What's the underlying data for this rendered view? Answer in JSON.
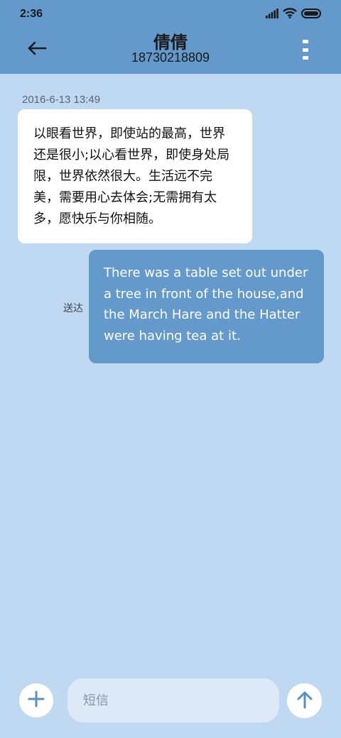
{
  "status_bar": {
    "time": "2:36",
    "icons": [
      "signal-icon",
      "wifi-icon",
      "battery-icon"
    ]
  },
  "header": {
    "contact_name": "倩倩",
    "contact_number": "18730218809",
    "back_icon": "arrow-left-icon",
    "menu_icon": "more-vertical-icon"
  },
  "conversation": {
    "timestamp": "2016-6-13 13:49",
    "messages": [
      {
        "direction": "incoming",
        "text": "以眼看世界，即使站的最高，世界还是很小;以心看世界，即使身处局限，世界依然很大。生活远不完美，需要用心去体会;无需拥有太多，愿快乐与你相随。"
      },
      {
        "direction": "outgoing",
        "text": "There was a table set out under a tree in front of the house,and the March Hare and the Hatter were having tea at it.",
        "status": "送达"
      }
    ]
  },
  "composer": {
    "placeholder": "短信",
    "value": "",
    "add_icon": "plus-icon",
    "send_icon": "arrow-up-icon"
  },
  "colors": {
    "header_bg": "#6499cb",
    "screen_bg": "#bfd9f2",
    "incoming_bubble": "#ffffff",
    "outgoing_bubble": "#6499cb",
    "input_bg": "#dde9f6",
    "accent_icon": "#5b8fc4"
  }
}
